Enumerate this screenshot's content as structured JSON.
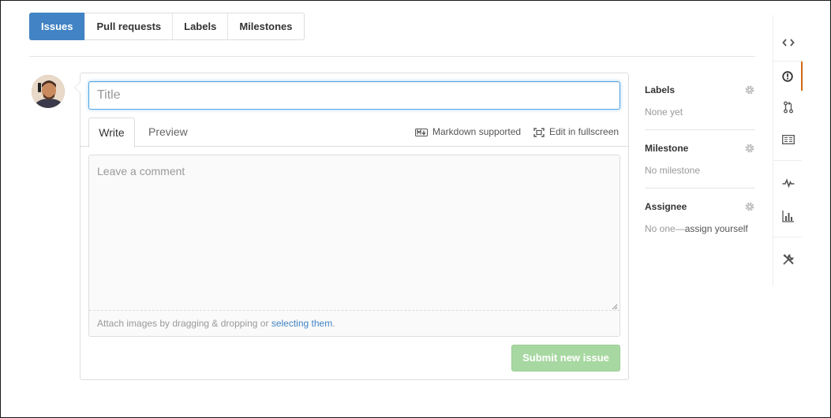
{
  "subnav": {
    "items": [
      {
        "label": "Issues",
        "selected": true
      },
      {
        "label": "Pull requests",
        "selected": false
      },
      {
        "label": "Labels",
        "selected": false
      },
      {
        "label": "Milestones",
        "selected": false
      }
    ]
  },
  "form": {
    "title_placeholder": "Title",
    "tabs": {
      "write": "Write",
      "preview": "Preview"
    },
    "markdown_label": "Markdown supported",
    "fullscreen_label": "Edit in fullscreen",
    "comment_placeholder": "Leave a comment",
    "attach_text": "Attach images by dragging & dropping or ",
    "attach_link": "selecting them",
    "attach_end": ".",
    "submit_label": "Submit new issue"
  },
  "sidebar": {
    "labels": {
      "heading": "Labels",
      "value": "None yet"
    },
    "milestone": {
      "heading": "Milestone",
      "value": "No milestone"
    },
    "assignee": {
      "heading": "Assignee",
      "value_prefix": "No one—",
      "value_link": "assign yourself"
    }
  },
  "repo_nav": {
    "icons": [
      "code-icon",
      "issue-icon",
      "pull-request-icon",
      "wiki-icon",
      "pulse-icon",
      "graph-icon",
      "settings-icon"
    ],
    "accent_color": "#d26911"
  },
  "colors": {
    "primary": "#4183c4",
    "submit_disabled": "#a8d8a2",
    "focus": "#51a7e8"
  }
}
